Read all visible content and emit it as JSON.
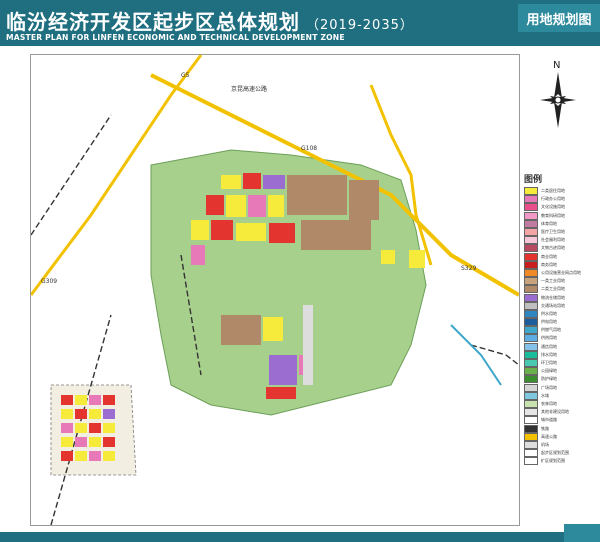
{
  "header": {
    "title": "临汾经济开发区起步区总体规划",
    "year": "（2019-2035）",
    "subtitle": "MASTER PLAN FOR LINFEN ECONOMIC AND TECHNICAL DEVELOPMENT ZONE",
    "badge": "用地规划图"
  },
  "north_arrow": {
    "label": "N",
    "icon": "compass-rose-icon"
  },
  "map": {
    "road_labels": {
      "g5": "G5",
      "g108": "G108",
      "s329": "S329",
      "g309": "G309",
      "expressway": "京昆高速公路"
    },
    "colors": {
      "background_green": "#a8d08d",
      "residential": "#f6ea3a",
      "commercial": "#e3342f",
      "industrial": "#b08968",
      "education": "#e879b9",
      "water": "#3fa7c9",
      "road": "#ffffff",
      "highway": "#f2c200"
    }
  },
  "legend": {
    "title": "图例",
    "items": [
      {
        "label": "二类居住用地",
        "color": "#f6ea3a"
      },
      {
        "label": "行政办公用地",
        "color": "#e879b9"
      },
      {
        "label": "文化设施用地",
        "color": "#e94f8a"
      },
      {
        "label": "教育科研用地",
        "color": "#f29ac5"
      },
      {
        "label": "体育用地",
        "color": "#c27ba0"
      },
      {
        "label": "医疗卫生用地",
        "color": "#f4a6a6"
      },
      {
        "label": "社会福利用地",
        "color": "#f7c6d9"
      },
      {
        "label": "文物古迹用地",
        "color": "#b84a62"
      },
      {
        "label": "商业用地",
        "color": "#e3342f"
      },
      {
        "label": "商务用地",
        "color": "#c81e1e"
      },
      {
        "label": "公用设施营业网点用地",
        "color": "#f08a24"
      },
      {
        "label": "一类工业用地",
        "color": "#c8a27a"
      },
      {
        "label": "二类工业用地",
        "color": "#b08968"
      },
      {
        "label": "物流仓储用地",
        "color": "#9b6dd1"
      },
      {
        "label": "交通场站用地",
        "color": "#bfbfbf"
      },
      {
        "label": "供水用地",
        "color": "#2e86c1"
      },
      {
        "label": "供电用地",
        "color": "#1b5e9b"
      },
      {
        "label": "供燃气用地",
        "color": "#3fa7c9"
      },
      {
        "label": "供热用地",
        "color": "#5dade2"
      },
      {
        "label": "通信用地",
        "color": "#85c1e9"
      },
      {
        "label": "排水用地",
        "color": "#1abc9c"
      },
      {
        "label": "环卫用地",
        "color": "#48c9b0"
      },
      {
        "label": "公园绿地",
        "color": "#6ab04c"
      },
      {
        "label": "防护绿地",
        "color": "#3c8d2f"
      },
      {
        "label": "广场用地",
        "color": "#d5d5d5"
      },
      {
        "label": "水域",
        "color": "#7fc8e0"
      },
      {
        "label": "农林用地",
        "color": "#c9e3b0"
      },
      {
        "label": "其他非建设用地",
        "color": "#e6e6e6"
      },
      {
        "label": "城市道路",
        "color": "#ffffff"
      },
      {
        "label": "铁路",
        "color": "#333333"
      },
      {
        "label": "高速公路",
        "color": "#f2c200"
      },
      {
        "label": "机场",
        "color": "#dddddd"
      },
      {
        "label": "起步区规划范围",
        "color": "#ffffff"
      },
      {
        "label": "扩区规划范围",
        "color": "#ffffff"
      }
    ]
  }
}
